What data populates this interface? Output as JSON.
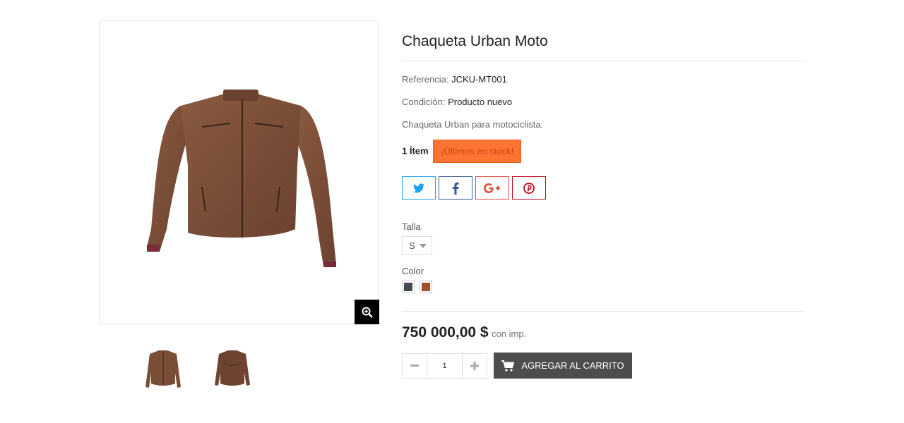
{
  "product": {
    "title": "Chaqueta Urban Moto",
    "reference_label": "Referencia:",
    "reference_value": "JCKU-MT001",
    "condition_label": "Condición:",
    "condition_value": "Producto nuevo",
    "short_description": "Chaqueta Urban para motociclista.",
    "quantity_text": "1 Ítem",
    "stock_badge": "¡Últimos en stock!",
    "price": "750 000,00 $",
    "price_tax_note": "con imp."
  },
  "share": {
    "buttons": [
      {
        "icon": "twitter-icon",
        "color": "#1da1f2"
      },
      {
        "icon": "facebook-icon",
        "color": "#3b5998"
      },
      {
        "icon": "google-plus-icon",
        "color": "#dd4b39"
      },
      {
        "icon": "pinterest-icon",
        "color": "#bd081c"
      }
    ]
  },
  "variants": {
    "size_label": "Talla",
    "size_selected": "S",
    "color_label": "Color",
    "colors": [
      "#434a54",
      "#a0522d"
    ]
  },
  "cart": {
    "quantity": "1",
    "add_to_cart_label": "AGREGAR AL CARRITO"
  },
  "colors": {
    "stock_badge_bg": "#ff7433",
    "add_cart_bg": "#4d4d4d",
    "jacket_brown": "#7a4e36"
  }
}
